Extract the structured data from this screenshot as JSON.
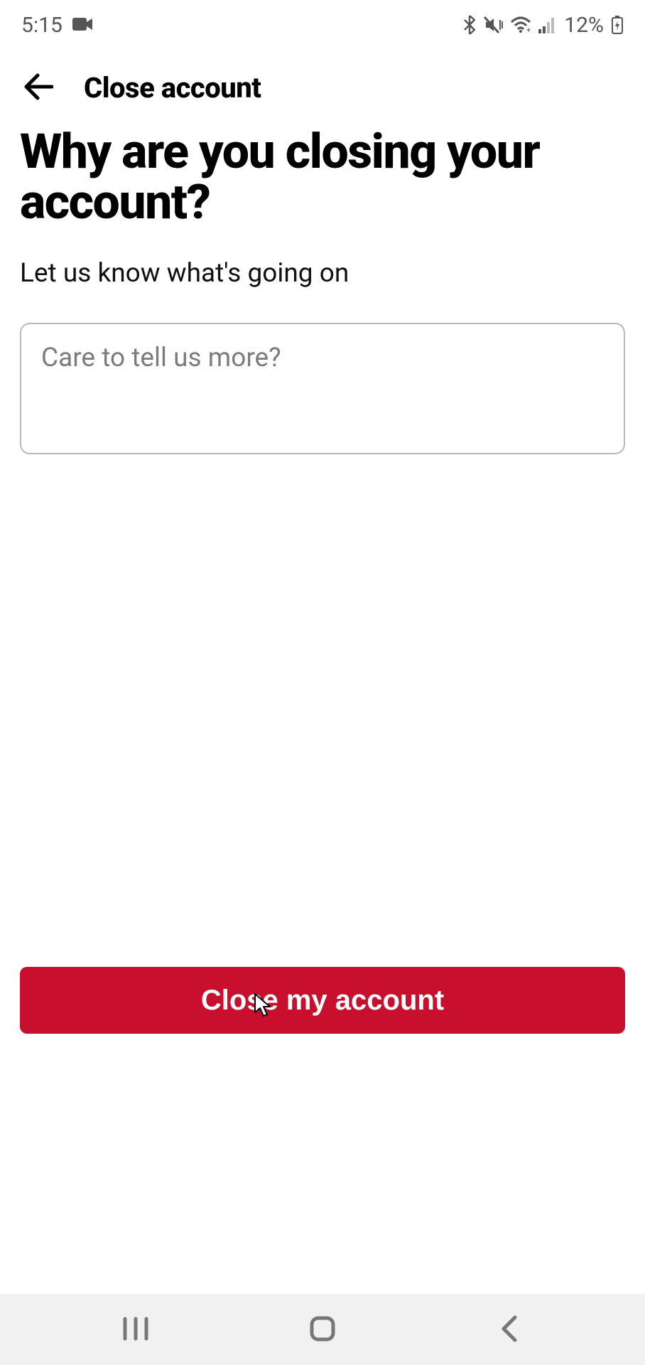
{
  "status_bar": {
    "time": "5:15",
    "battery_percent": "12%"
  },
  "header": {
    "title": "Close account"
  },
  "page": {
    "heading": "Why are you closing your account?",
    "subheading": "Let us know what's going on",
    "feedback_placeholder": "Care to tell us more?"
  },
  "cta": {
    "label": "Close my account"
  }
}
